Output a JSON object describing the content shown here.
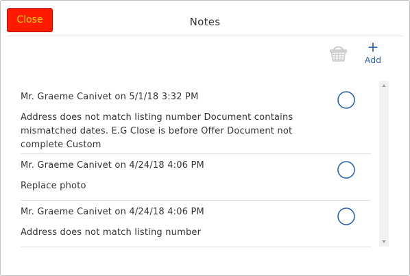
{
  "header": {
    "close_label": "Close",
    "title": "Notes"
  },
  "toolbar": {
    "delete_icon": "basket-icon",
    "add_icon": "plus-icon",
    "add_label": "Add"
  },
  "notes": [
    {
      "meta": "Mr. Graeme Canivet on 5/1/18 3:32 PM",
      "text": "Address does not match listing number Document contains mismatched dates. E.G Close is before Offer Document not complete Custom"
    },
    {
      "meta": "Mr. Graeme Canivet on 4/24/18 4:06 PM",
      "text": "Replace photo"
    },
    {
      "meta": "Mr. Graeme Canivet on 4/24/18 4:06 PM",
      "text": "Address does not match listing number"
    }
  ],
  "colors": {
    "close_bg": "#ff1a00",
    "close_text": "#ffd400",
    "accent": "#2b63b0",
    "radio": "#2b63b0"
  }
}
